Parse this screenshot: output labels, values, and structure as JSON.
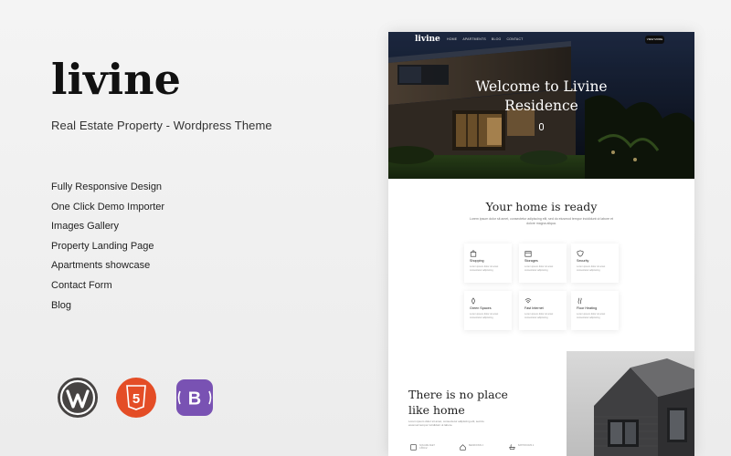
{
  "brand": {
    "name": "livine",
    "subtitle": "Real Estate Property - Wordpress Theme"
  },
  "features": [
    "Fully Responsive Design",
    "One Click Demo Importer",
    "Images Gallery",
    "Property Landing Page",
    "Apartments showcase",
    "Contact Form",
    "Blog"
  ],
  "badges": [
    {
      "name": "wordpress-logo",
      "color": "#464342"
    },
    {
      "name": "html5-logo",
      "color": "#e44d26",
      "text": "5"
    },
    {
      "name": "bootstrap-logo",
      "color": "#7952b3",
      "text": "B"
    }
  ],
  "mockup": {
    "nav": {
      "logo": "livine",
      "links": [
        "HOME",
        "APARTMENTS",
        "BLOG",
        "CONTACT"
      ],
      "cta": "VIEW MORE"
    },
    "hero": {
      "title": "Welcome to Livine Residence"
    },
    "amenities_section": {
      "title": "Your home is ready",
      "description": "Lorem ipsum dolor sit amet, consectetur adipiscing elit, sed do eiusmod tempor incididunt ut labore et dolore magna aliqua."
    },
    "amenities": [
      {
        "name": "Shopping",
        "icon": "shopping-bag-icon",
        "desc": "Lorem ipsum dolor sit amet consectetur adipiscing"
      },
      {
        "name": "Storages",
        "icon": "box-icon",
        "desc": "Lorem ipsum dolor sit amet consectetur adipiscing"
      },
      {
        "name": "Security",
        "icon": "shield-icon",
        "desc": "Lorem ipsum dolor sit amet consectetur adipiscing"
      },
      {
        "name": "Green Spaces",
        "icon": "leaf-icon",
        "desc": "Lorem ipsum dolor sit amet consectetur adipiscing"
      },
      {
        "name": "Fast Internet",
        "icon": "wifi-icon",
        "desc": "Lorem ipsum dolor sit amet consectetur adipiscing"
      },
      {
        "name": "Floor Heating",
        "icon": "heat-icon",
        "desc": "Lorem ipsum dolor sit amet consectetur adipiscing"
      }
    ],
    "promo": {
      "title": "There is no place like home",
      "description": "Lorem ipsum dolor sit amet, consectetur adipiscing elit, sed do eiusmod tempor incididunt ut labore."
    },
    "stats": [
      {
        "label": "SQUARE FEET 1450m2",
        "icon": "area-icon"
      },
      {
        "label": "BEDROOMS 4",
        "icon": "home-icon"
      },
      {
        "label": "BATHROOMS 2",
        "icon": "bath-icon"
      }
    ]
  }
}
